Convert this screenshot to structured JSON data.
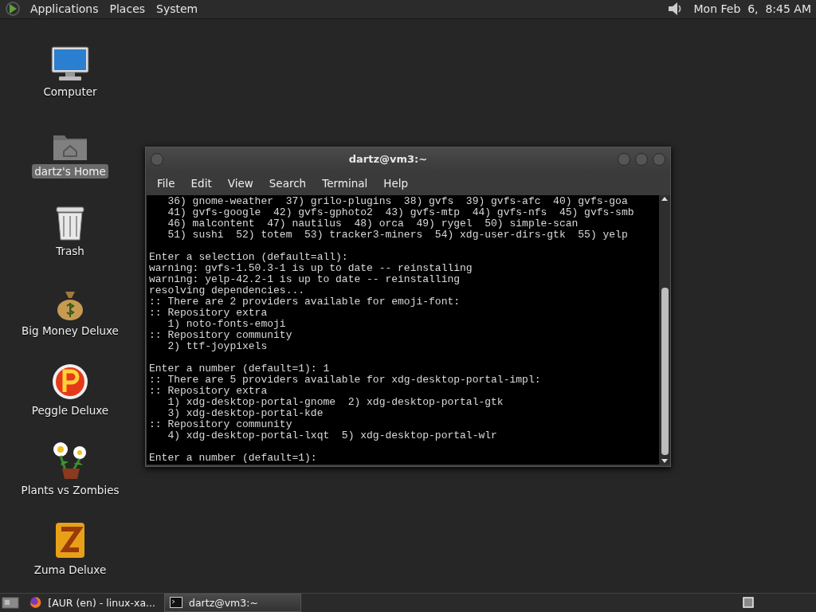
{
  "top_panel": {
    "menus": [
      "Applications",
      "Places",
      "System"
    ],
    "clock": "Mon Feb  6,  8:45 AM"
  },
  "desktop_icons": [
    {
      "label": "Computer",
      "kind": "computer",
      "selected": false
    },
    {
      "label": "dartz's Home",
      "kind": "home",
      "selected": true
    },
    {
      "label": "Trash",
      "kind": "trash",
      "selected": false
    },
    {
      "label": "Big Money Deluxe",
      "kind": "moneybag",
      "selected": false
    },
    {
      "label": "Peggle Deluxe",
      "kind": "peggle",
      "selected": false
    },
    {
      "label": "Plants vs Zombies",
      "kind": "plant",
      "selected": false
    },
    {
      "label": "Zuma Deluxe",
      "kind": "zuma",
      "selected": false
    }
  ],
  "terminal": {
    "title": "dartz@vm3:~",
    "menu": [
      "File",
      "Edit",
      "View",
      "Search",
      "Terminal",
      "Help"
    ],
    "blocks": [
      [
        "   36) gnome-weather  37) grilo-plugins  38) gvfs  39) gvfs-afc  40) gvfs-goa",
        "   41) gvfs-google  42) gvfs-gphoto2  43) gvfs-mtp  44) gvfs-nfs  45) gvfs-smb",
        "   46) malcontent  47) nautilus  48) orca  49) rygel  50) simple-scan",
        "   51) sushi  52) totem  53) tracker3-miners  54) xdg-user-dirs-gtk  55) yelp"
      ],
      [
        "Enter a selection (default=all):",
        "warning: gvfs-1.50.3-1 is up to date -- reinstalling",
        "warning: yelp-42.2-1 is up to date -- reinstalling",
        "resolving dependencies...",
        ":: There are 2 providers available for emoji-font:",
        ":: Repository extra",
        "   1) noto-fonts-emoji",
        ":: Repository community",
        "   2) ttf-joypixels"
      ],
      [
        "Enter a number (default=1): 1",
        ":: There are 5 providers available for xdg-desktop-portal-impl:",
        ":: Repository extra",
        "   1) xdg-desktop-portal-gnome  2) xdg-desktop-portal-gtk",
        "   3) xdg-desktop-portal-kde",
        ":: Repository community",
        "   4) xdg-desktop-portal-lxqt  5) xdg-desktop-portal-wlr"
      ],
      [
        "Enter a number (default=1):"
      ]
    ]
  },
  "taskbar": {
    "items": [
      {
        "label": "[AUR (en) - linux-xa...",
        "kind": "browser",
        "selected": false
      },
      {
        "label": "dartz@vm3:~",
        "kind": "terminal",
        "selected": true
      }
    ]
  }
}
